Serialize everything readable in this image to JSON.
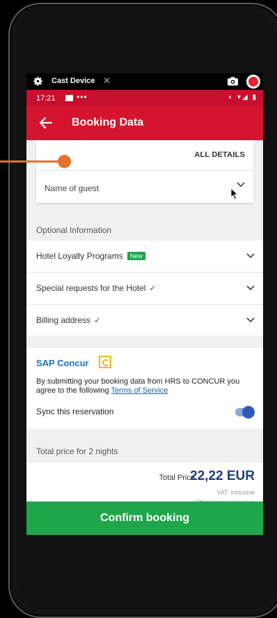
{
  "cast_bar": {
    "title": "Cast Device",
    "close_symbol": "✕"
  },
  "status_bar": {
    "time": "17:21",
    "dots": "•••",
    "system_icons": "◐ ▾◢ ▮"
  },
  "app_bar": {
    "title": "Booking Data"
  },
  "guest_card": {
    "all_details": "ALL DETAILS",
    "name_of_guest": "Name of guest"
  },
  "optional": {
    "heading": "Optional Information",
    "items": [
      {
        "label": "Hotel Loyalty Programs",
        "badge": "New"
      },
      {
        "label": "Special requests for the Hotel",
        "check": "✓"
      },
      {
        "label": "Billing address",
        "check": "✓"
      }
    ]
  },
  "concur": {
    "brand": "SAP Concur",
    "text": "By submitting your booking data from HRS to CONCUR you agree to the following",
    "link": "Terms of Service",
    "sync_label": "Sync this reservation",
    "sync_on": true
  },
  "total": {
    "heading": "Total price for 2 nights",
    "caption": "Total Price",
    "price": "22,22 EUR",
    "vat": "VAT: inclusive",
    "other_taxes": "Other taxes: inclusive"
  },
  "confirm": {
    "label": "Confirm booking"
  },
  "colors": {
    "app_bar": "#d5142e",
    "status_bar": "#c8102e",
    "confirm": "#1fa64a",
    "badge": "#1aa64a",
    "price": "#1f3f7a",
    "toggle": "#2f5bb7",
    "annotation": "#e8722a"
  }
}
